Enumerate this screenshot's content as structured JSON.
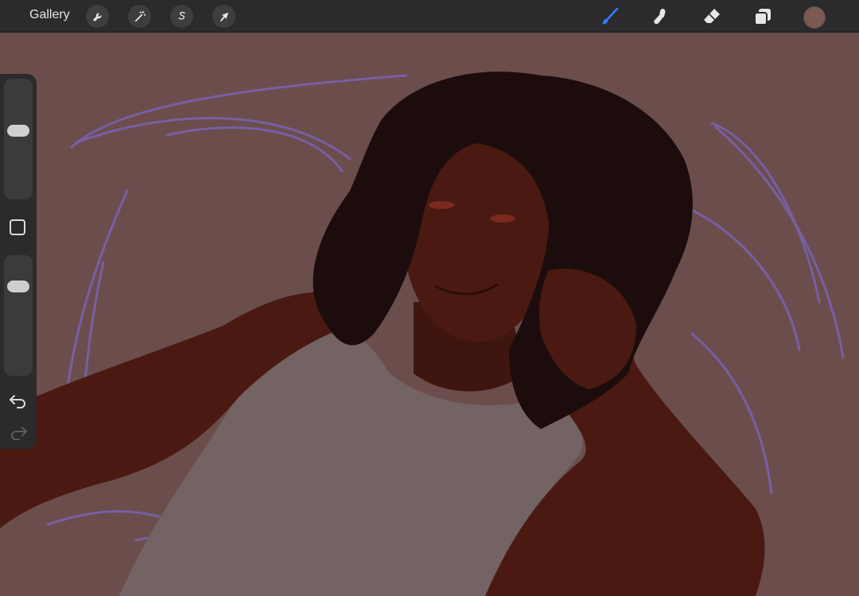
{
  "toolbar": {
    "gallery_label": "Gallery",
    "left_tools": [
      {
        "name": "actions",
        "icon": "wrench-icon"
      },
      {
        "name": "adjustments",
        "icon": "magic-wand-icon"
      },
      {
        "name": "selection",
        "icon": "selection-s-icon"
      },
      {
        "name": "transform",
        "icon": "arrow-cursor-icon"
      }
    ],
    "right_tools": [
      {
        "name": "brush",
        "icon": "brush-icon",
        "active": true
      },
      {
        "name": "smudge",
        "icon": "smudge-finger-icon"
      },
      {
        "name": "eraser",
        "icon": "eraser-icon"
      },
      {
        "name": "layers",
        "icon": "layers-icon"
      }
    ],
    "current_color": "#7b5a51",
    "accent_color": "#2f7df6"
  },
  "sidebar": {
    "brush_size_level": 0.58,
    "opacity_level": 0.74,
    "modify_icon": "square-outline-icon",
    "undo_icon": "undo-arrow-icon",
    "redo_icon": "redo-arrow-icon",
    "redo_enabled": false
  },
  "canvas": {
    "background_color": "#6b4d4c",
    "skin_color": "#4a1a12",
    "hair_color": "#1c0d0c",
    "shirt_color": "#736363",
    "sketch_color": "#7a63b4"
  }
}
